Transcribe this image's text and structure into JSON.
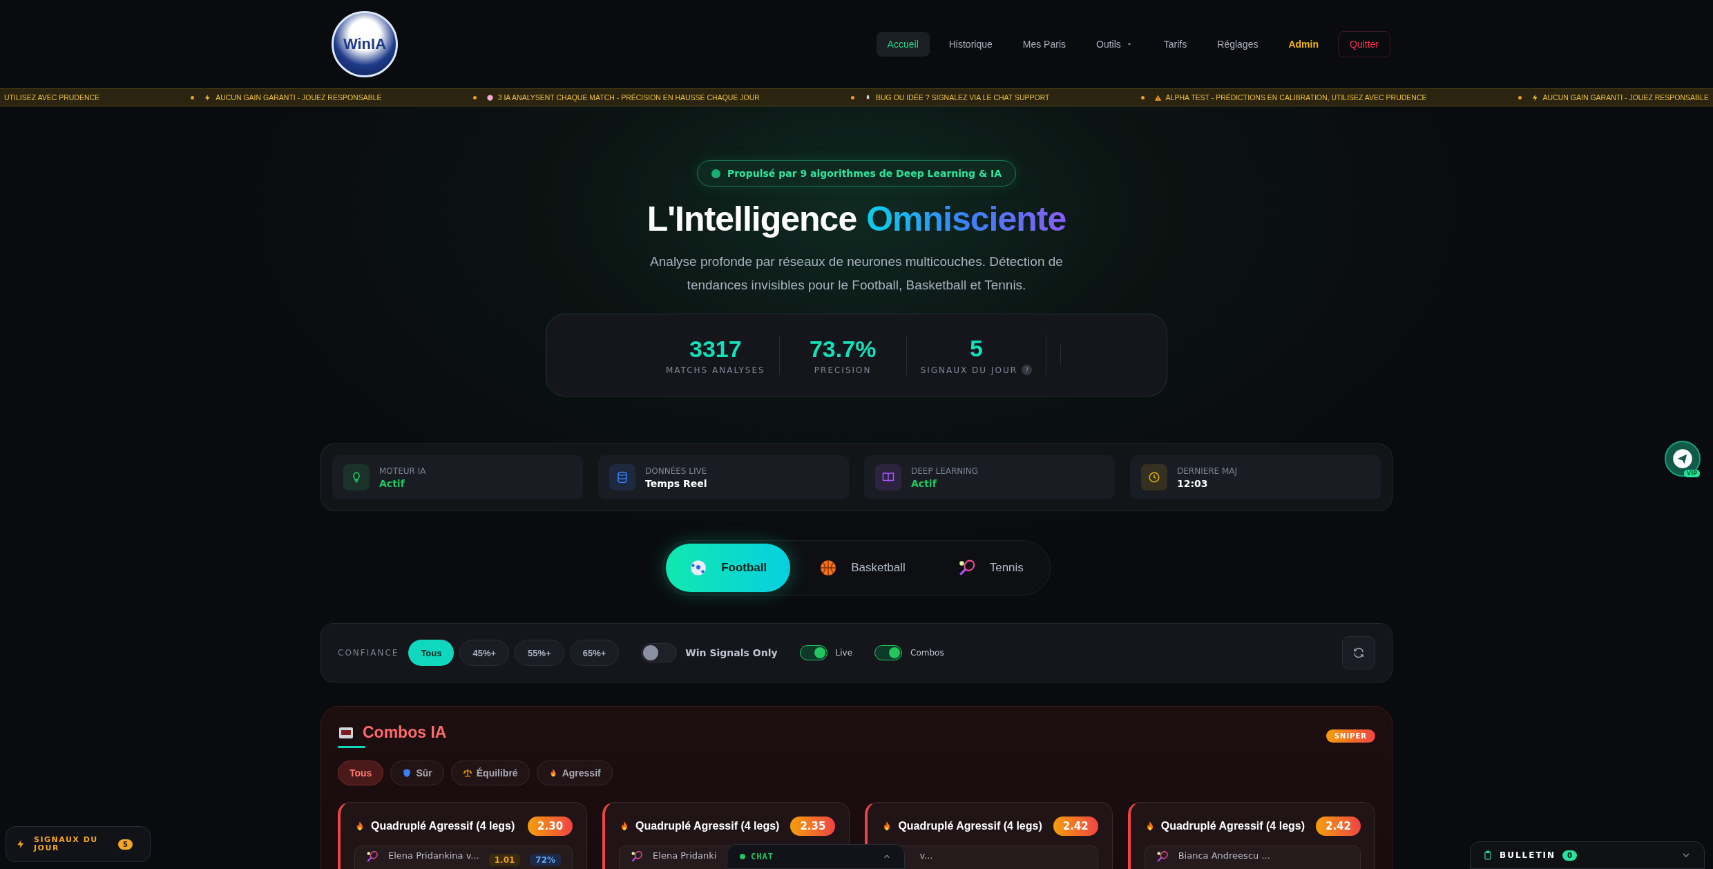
{
  "header": {
    "logo_text": "WinIA",
    "nav": [
      {
        "label": "Accueil",
        "kind": "link",
        "selected": true
      },
      {
        "label": "Historique",
        "kind": "link",
        "selected": false
      },
      {
        "label": "Mes Paris",
        "kind": "link",
        "selected": false
      },
      {
        "label": "Outils",
        "kind": "menu",
        "selected": false
      },
      {
        "label": "Tarifs",
        "kind": "link",
        "selected": false
      },
      {
        "label": "Réglages",
        "kind": "link",
        "selected": false
      },
      {
        "label": "Admin",
        "kind": "admin",
        "selected": false
      },
      {
        "label": "Quitter",
        "kind": "logout",
        "selected": false
      }
    ]
  },
  "ticker": [
    {
      "text": "UTILISEZ AVEC PRUDENCE"
    },
    {
      "text": "AUCUN GAIN GARANTI - JOUEZ RESPONSABLE"
    },
    {
      "text": "3 IA ANALYSENT CHAQUE MATCH - PRÉCISION EN HAUSSE CHAQUE JOUR"
    },
    {
      "text": "BUG OU IDÉE ? SIGNALEZ VIA LE CHAT SUPPORT"
    },
    {
      "text": "ALPHA TEST - PRÉDICTIONS EN CALIBRATION, UTILISEZ AVEC PRUDENCE"
    },
    {
      "text": "AUCUN GAIN GARANTI - JOUEZ RESPONSABLE"
    }
  ],
  "hero": {
    "badge": "Propulsé par 9 algorithmes de Deep Learning & IA",
    "title": "L'Intelligence",
    "title_accent": "Omnisciente",
    "subtitle": "Analyse profonde par réseaux de neurones multicouches. Détection de tendances invisibles pour le Football, Basketball et Tennis.",
    "stats": [
      {
        "value": "3317",
        "label": "MATCHS ANALYSES"
      },
      {
        "value": "73.7%",
        "label": "PRECISION"
      },
      {
        "value": "5",
        "label": "SIGNAUX DU JOUR",
        "help_text": "?"
      }
    ]
  },
  "status_cards": [
    {
      "label": "MOTEUR IA",
      "value": "Actif",
      "active": true
    },
    {
      "label": "DONNÉES LIVE",
      "value": "Temps Reel",
      "active": false
    },
    {
      "label": "DEEP LEARNING",
      "value": "Actif",
      "active": true
    },
    {
      "label": "DERNIERE MAJ",
      "value": "12:03",
      "active": false
    }
  ],
  "sport_tabs": [
    {
      "label": "Football",
      "selected": true
    },
    {
      "label": "Basketball",
      "selected": false
    },
    {
      "label": "Tennis",
      "selected": false
    }
  ],
  "filters": {
    "label": "CONFIANCE",
    "options": [
      {
        "label": "Tous",
        "selected": true
      },
      {
        "label": "45%+",
        "selected": false
      },
      {
        "label": "55%+",
        "selected": false
      },
      {
        "label": "65%+",
        "selected": false
      }
    ],
    "toggles": [
      {
        "label": "Win Signals Only",
        "on": false
      },
      {
        "label": "Live",
        "on": true
      },
      {
        "label": "Combos",
        "on": true
      }
    ]
  },
  "combos": {
    "title": "Combos IA",
    "badge": "SNIPER",
    "filters": [
      {
        "label": "Tous",
        "selected": true
      },
      {
        "label": "Sûr",
        "selected": false
      },
      {
        "label": "Équilibré",
        "selected": false
      },
      {
        "label": "Agressif",
        "selected": false
      }
    ],
    "cards": [
      {
        "title": "Quadruplé Agressif (4 legs)",
        "odds": "2.30",
        "leg": {
          "match": "Elena Pridankina v...",
          "odds": "1.01",
          "confidence": "72%"
        }
      },
      {
        "title": "Quadruplé Agressif (4 legs)",
        "odds": "2.35",
        "leg": {
          "match": "Elena Pridanki"
        }
      },
      {
        "title": "Quadruplé Agressif (4 legs)",
        "odds": "2.42",
        "leg": {
          "match": "v..."
        }
      },
      {
        "title": "Quadruplé Agressif (4 legs)",
        "odds": "2.42",
        "leg": {
          "match": "Bianca Andreescu ..."
        }
      }
    ]
  },
  "signals_widget": {
    "label": "SIGNAUX DU JOUR",
    "count": "5"
  },
  "chat": {
    "label": "CHAT"
  },
  "bulletin": {
    "label": "BULLETIN",
    "count": "0"
  },
  "telegram": {
    "badge": "VIP"
  }
}
